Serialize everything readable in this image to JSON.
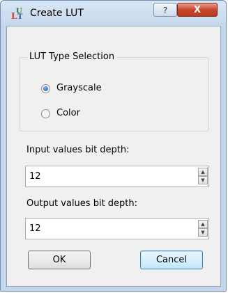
{
  "window": {
    "title": "Create LUT",
    "help_glyph": "?",
    "close_glyph": "X"
  },
  "group": {
    "title": "LUT Type Selection",
    "options": [
      {
        "label": "Grayscale",
        "selected": true
      },
      {
        "label": "Color",
        "selected": false
      }
    ]
  },
  "input": {
    "label": "Input values bit depth:",
    "value": "12"
  },
  "output": {
    "label": "Output values bit depth:",
    "value": "12"
  },
  "buttons": {
    "ok": "OK",
    "cancel": "Cancel"
  },
  "icons": {
    "app": "lut-app-icon",
    "help": "help-icon",
    "close": "close-icon",
    "spin_up": "spin-up-icon",
    "spin_down": "spin-down-icon"
  }
}
